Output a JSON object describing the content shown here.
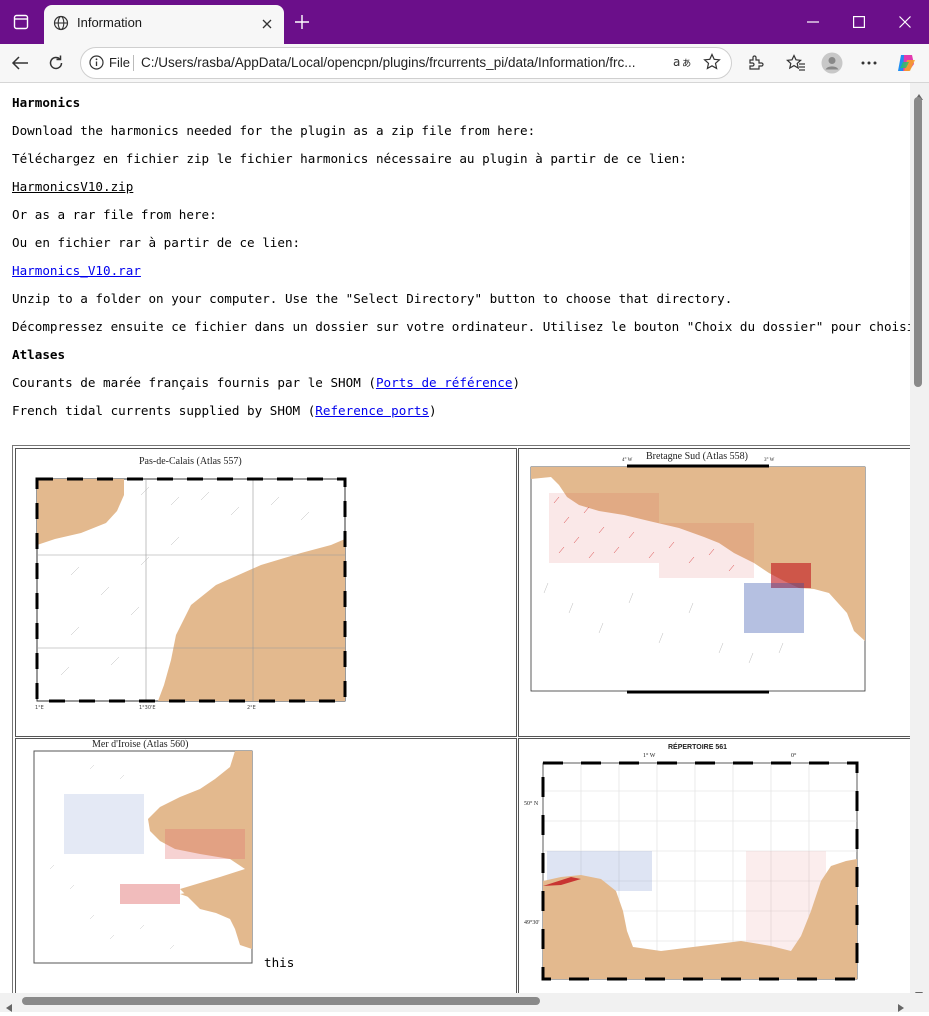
{
  "browser": {
    "tab_title": "Information",
    "scheme_label": "File",
    "url": "C:/Users/rasba/AppData/Local/opencpn/plugins/frcurrents_pi/data/Information/frc...",
    "accent": "#6b0f8a"
  },
  "page": {
    "h_harmonics": "Harmonics",
    "line1": "Download the harmonics needed for the plugin as a zip file from here:",
    "line2": "Téléchargez en fichier zip le fichier harmonics nécessaire au plugin à partir de ce lien:",
    "link_zip": "HarmonicsV10.zip",
    "line3": "Or as a rar file from here:",
    "line4": "Ou en fichier rar à partir de ce lien:",
    "link_rar": "Harmonics_V10.rar",
    "line5": "Unzip to a folder on your computer. Use the \"Select Directory\" button to choose that directory.",
    "line6": "Décompressez ensuite ce fichier dans un dossier sur votre ordinateur. Utilisez le bouton \"Choix du dossier\" pour choisir ce ré",
    "h_atlases": "Atlases",
    "line7_pre": "Courants de marée français fournis par le SHOM (",
    "link_ports_fr": "Ports de référence",
    "line7_post": ")",
    "line8_pre": "French tidal currents supplied by SHOM (",
    "link_ports_en": "Reference ports",
    "line8_post": ")",
    "this_text": "this"
  },
  "maps": {
    "map1_title": "Pas-de-Calais (Atlas 557)",
    "map2_title": "Bretagne Sud (Atlas 558)",
    "map3_title": "Mer d'Iroise (Atlas 560)",
    "map4_title": "RÉPERTOIRE 561",
    "map4_lat_top": "50° N",
    "map4_lat_mid": "49°30'",
    "map4_lon_a": "1° W",
    "map4_lon_b": "0°",
    "map2_lon_a": "4° W",
    "map2_lon_b": "3° W",
    "land_color": "#e3b98e"
  }
}
